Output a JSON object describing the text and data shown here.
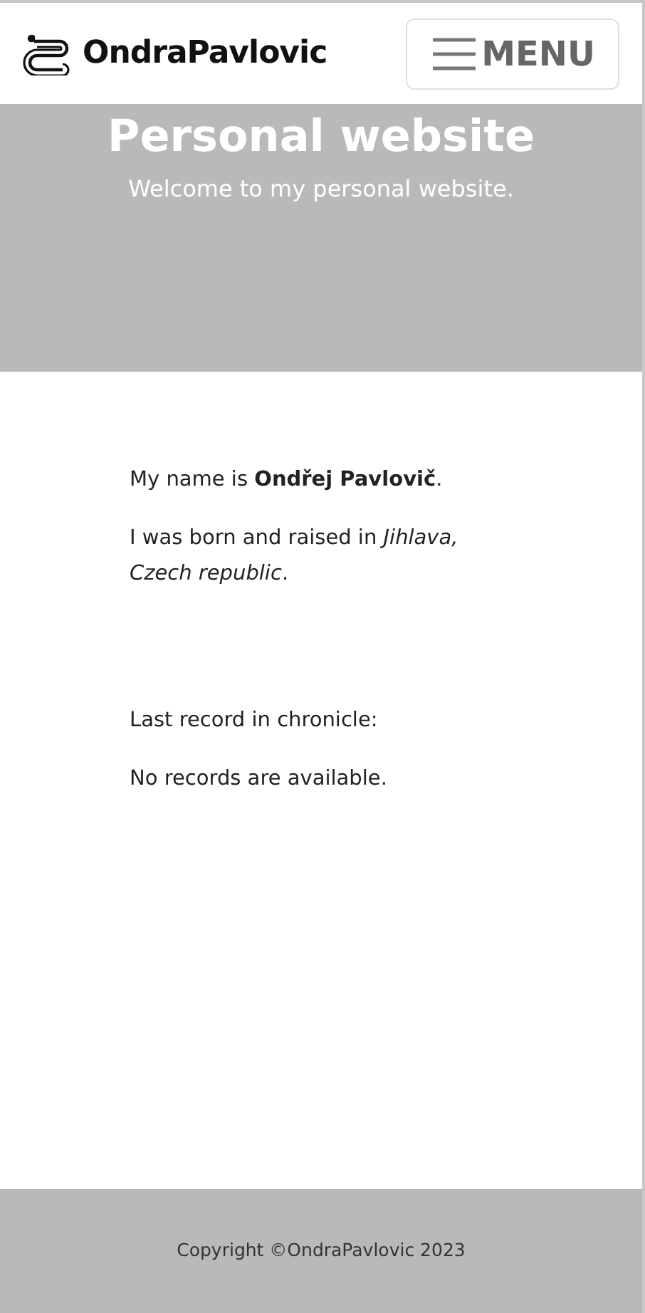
{
  "header": {
    "logo_text": "OndraPavlovic",
    "menu_button": "MENU"
  },
  "hero": {
    "title": "Personal website",
    "subtitle": "Welcome to my personal website."
  },
  "content": {
    "paragraphs": [
      "My name is **Ondřej Pavlovič**.",
      "I was born and raised in *Jihlava, Czech republic*."
    ],
    "chronicle_label": "Last record in chronicle:",
    "chronicle_empty": "No records are available."
  },
  "footer": {
    "copyright": "Copyright ©OndraPavlovic 2023"
  }
}
